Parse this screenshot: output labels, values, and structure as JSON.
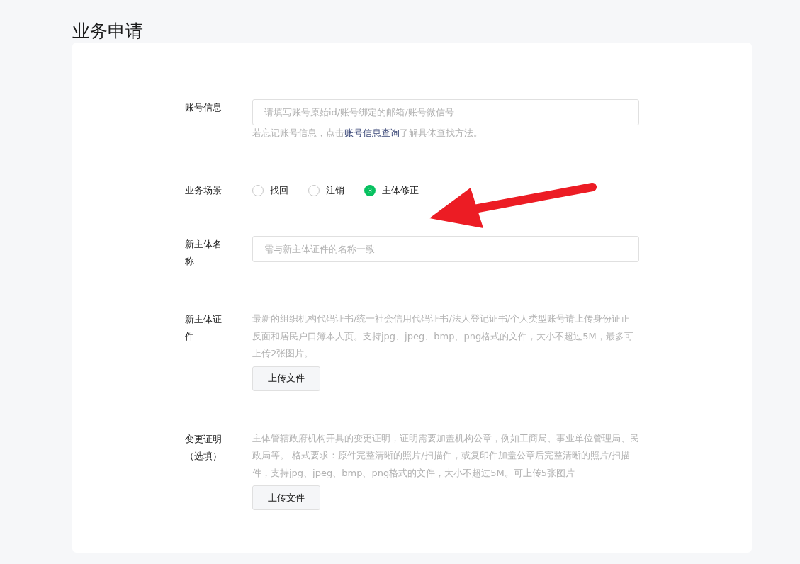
{
  "page_title": "业务申请",
  "form": [
    {
      "kind": "text",
      "label": "账号信息",
      "placeholder": "请填写账号原始id/账号绑定的邮箱/账号微信号",
      "hint": {
        "before": "若忘记账号信息，点击",
        "link": "账号信息查询",
        "after": "了解具体查找方法。"
      }
    },
    {
      "kind": "radio",
      "label": "业务场景",
      "options": [
        {
          "label": "找回",
          "selected": false
        },
        {
          "label": "注销",
          "selected": false
        },
        {
          "label": "主体修正",
          "selected": true
        }
      ]
    },
    {
      "kind": "text",
      "label": "新主体名称",
      "placeholder": "需与新主体证件的名称一致"
    },
    {
      "kind": "upload",
      "label": "新主体证件",
      "description": "最新的组织机构代码证书/统一社会信用代码证书/法人登记证书/个人类型账号请上传身份证正反面和居民户口簿本人页。支持jpg、jpeg、bmp、png格式的文件，大小不超过5M，最多可上传2张图片。",
      "button": "上传文件"
    },
    {
      "kind": "upload",
      "label": "变更证明（选填）",
      "description": "主体管辖政府机构开具的变更证明，证明需要加盖机构公章，例如工商局、事业单位管理局、民政局等。 格式要求：原件完整清晰的照片/扫描件，或复印件加盖公章后完整清晰的照片/扫描件，支持jpg、jpeg、bmp、png格式的文件，大小不超过5M。可上传5张图片",
      "button": "上传文件"
    }
  ]
}
